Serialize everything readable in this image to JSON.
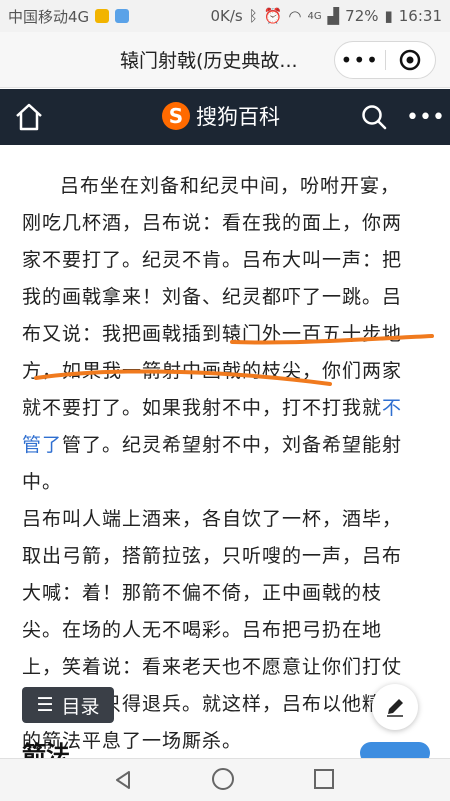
{
  "status": {
    "carrier": "中国移动4G",
    "speed": "0K/s",
    "network": "4G",
    "battery": "72%",
    "time": "16:31"
  },
  "titlebar": {
    "title": "辕门射戟(历史典故..."
  },
  "navbar": {
    "brand": "搜狗百科",
    "logo_letter": "S"
  },
  "article": {
    "lines": [
      "吕布坐在刘备和纪灵中间，吩咐开宴，",
      "刚吃几杯酒，吕布说：看在我的面上，你两",
      "家不要打了。纪灵不肯。吕布大叫一声：把",
      "我的画戟拿来！刘备、纪灵都吓了一跳。吕",
      "布又说：我把画戟插到辕门外一百五十步地",
      "方，如果我一箭射中画戟的枝尖，你们两家",
      "就不要打了。如果我射不中，打不打我就",
      "管了。纪灵希望射不中，刘备希望能射中。",
      "吕布叫人端上酒来，各自饮了一杯，酒毕，",
      "取出弓箭，搭箭拉弦，只听嗖的一声，吕布",
      "大喊：着！那箭不偏不倚，正中画戟的枝",
      "尖。在场的人无不喝彩。吕布把弓扔在地",
      "上，笑着说：看来老天也不愿意让你们打仗",
      "啊！纪灵只得退兵。就这样，吕布以他精湛",
      "的箭法平息了一场厮杀。"
    ],
    "link_a": "不",
    "link_b": "管了"
  },
  "toc_label": "目录",
  "section_heading": "箭法",
  "colors": {
    "nav_bg": "#1c2633",
    "brand_orange": "#ff6a00",
    "link_blue": "#2f6fd0",
    "annotation_orange": "#f07a1e"
  }
}
